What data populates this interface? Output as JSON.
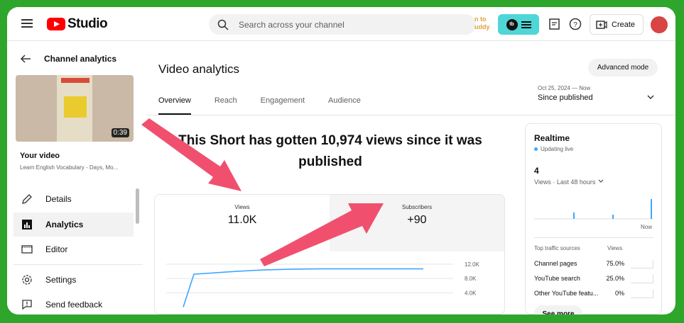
{
  "topbar": {
    "logo_text": "Studio",
    "search_placeholder": "Search across your channel",
    "tb_link": "n to\nuddy",
    "tb_badge": "tb",
    "create_label": "Create"
  },
  "sidebar": {
    "back_label": "Channel analytics",
    "thumbnail_duration": "0:39",
    "your_video": "Your video",
    "video_title": "Learn English Vocabulary - Days, Mo...",
    "items": [
      {
        "label": "Details",
        "icon": "pencil-icon"
      },
      {
        "label": "Analytics",
        "icon": "analytics-icon",
        "active": true
      },
      {
        "label": "Editor",
        "icon": "editor-icon"
      },
      {
        "label": "Settings",
        "icon": "gear-icon"
      },
      {
        "label": "Send feedback",
        "icon": "feedback-icon"
      }
    ]
  },
  "main": {
    "title": "Video analytics",
    "advanced_mode": "Advanced mode",
    "tabs": [
      "Overview",
      "Reach",
      "Engagement",
      "Audience"
    ],
    "date_range": "Oct 25, 2024 — Now",
    "date_label": "Since published",
    "annotation": "This Short has gotten 10,974 views since it was published",
    "metrics": {
      "views_label": "Views",
      "views_value": "11.0K",
      "subs_label": "Subscribers",
      "subs_value": "+90"
    }
  },
  "chart_data": {
    "type": "line",
    "series": [
      {
        "values": [
          0,
          9.2,
          10.0,
          10.4,
          10.6,
          10.7,
          10.7,
          10.7,
          10.7,
          10.7
        ]
      }
    ],
    "y_ticks": [
      "12.0K",
      "8.0K",
      "4.0K"
    ],
    "ylim": [
      0,
      12000
    ],
    "color": "#3ea6ff"
  },
  "realtime": {
    "title": "Realtime",
    "live": "Updating live",
    "count": "4",
    "subtitle": "Views · Last 48 hours",
    "now": "Now",
    "sources_header": "Top traffic sources",
    "views_header": "Views",
    "sources": [
      {
        "name": "Channel pages",
        "value": "75.0%"
      },
      {
        "name": "YouTube search",
        "value": "25.0%"
      },
      {
        "name": "Other YouTube featu...",
        "value": "0%"
      }
    ],
    "see_more": "See more"
  },
  "colors": {
    "brand_red": "#ff0000",
    "accent_blue": "#3ea6ff",
    "frame_green": "#2ea62c",
    "arrow_red": "#f0506e"
  }
}
